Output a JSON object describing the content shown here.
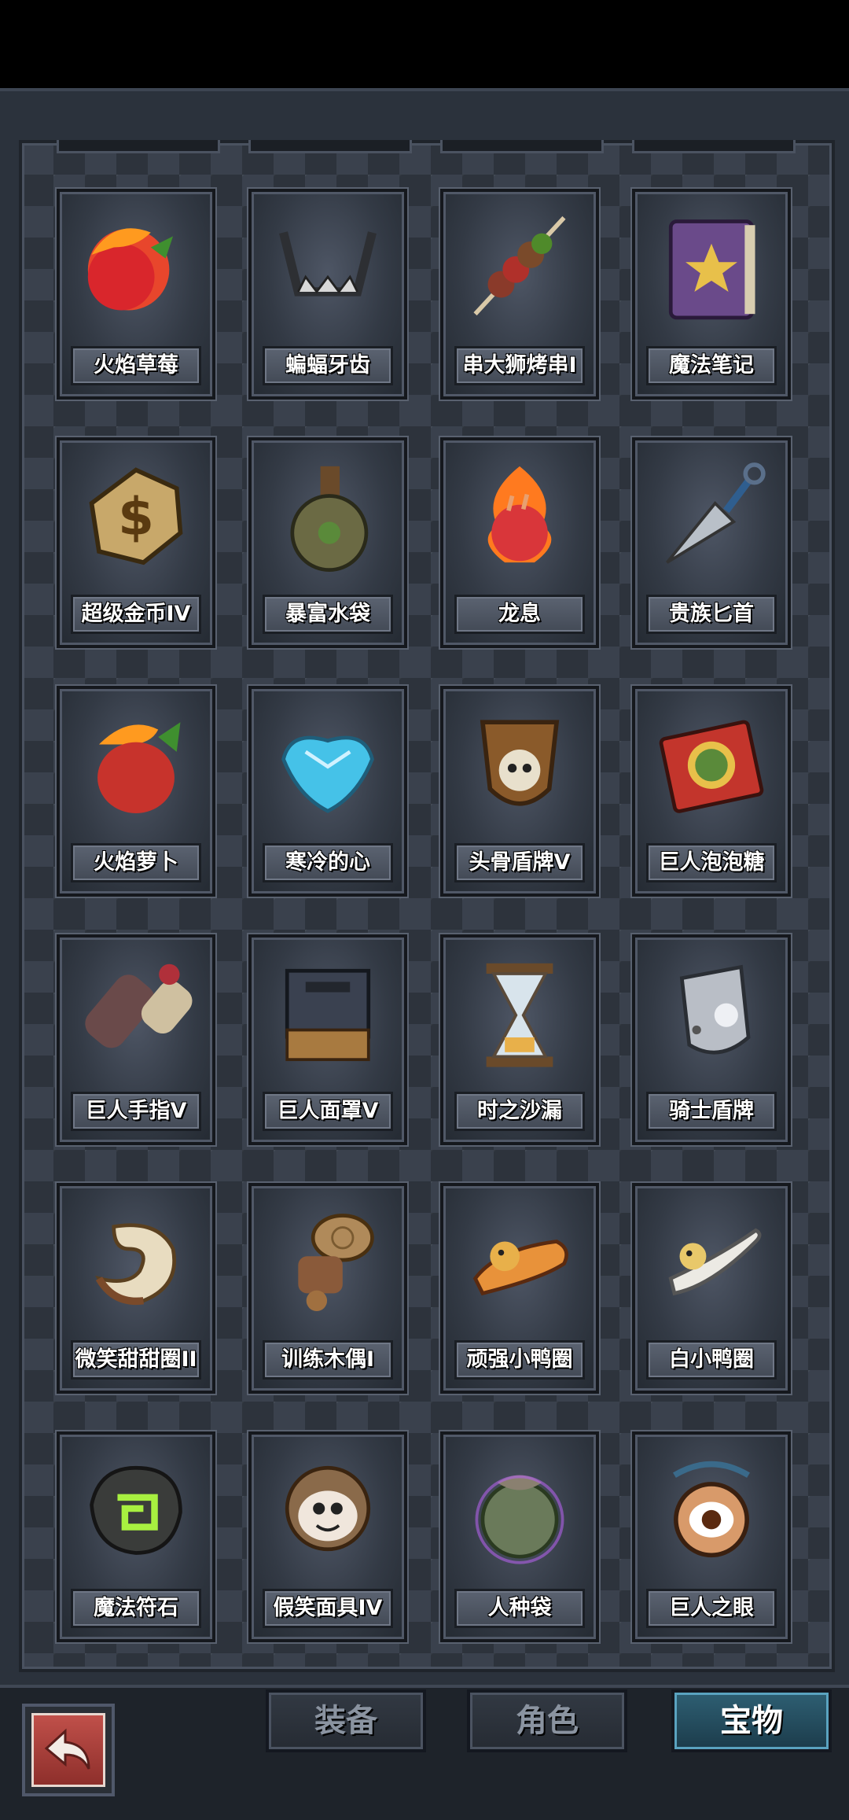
{
  "grid": {
    "rows": [
      [
        "火焰草莓",
        "蝙蝠牙齿",
        "串大狮烤串I",
        "魔法笔记"
      ],
      [
        "超级金币IV",
        "暴富水袋",
        "龙息",
        "贵族匕首"
      ],
      [
        "火焰萝卜",
        "寒冷的心",
        "头骨盾牌V",
        "巨人泡泡糖"
      ],
      [
        "巨人手指V",
        "巨人面罩V",
        "时之沙漏",
        "骑士盾牌"
      ],
      [
        "微笑甜甜圈II",
        "训练木偶I",
        "顽强小鸭圈",
        "白小鸭圈"
      ],
      [
        "魔法符石",
        "假笑面具IV",
        "人种袋",
        "巨人之眼"
      ]
    ]
  },
  "tabs": {
    "equipment": "装备",
    "character": "角色",
    "treasure": "宝物"
  },
  "colors": {
    "active_tab": "#2e5f73",
    "back_button": "#a8403b"
  },
  "icons": {
    "back": "undo-arrow-icon"
  }
}
